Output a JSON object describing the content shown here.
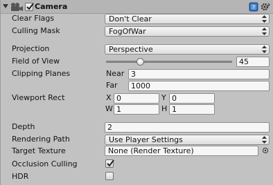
{
  "component": {
    "title": "Camera",
    "enabled": true,
    "icons": [
      "camera-icon",
      "help-icon",
      "gear-icon"
    ]
  },
  "properties": {
    "clear_flags": {
      "label": "Clear Flags",
      "value": "Don't Clear"
    },
    "culling_mask": {
      "label": "Culling Mask",
      "value": "FogOfWar"
    },
    "projection": {
      "label": "Projection",
      "value": "Perspective"
    },
    "field_of_view": {
      "label": "Field of View",
      "value": "45",
      "slider_fraction": 0.26
    },
    "clipping_planes": {
      "label": "Clipping Planes",
      "near_label": "Near",
      "near_value": "3",
      "far_label": "Far",
      "far_value": "1000"
    },
    "viewport_rect": {
      "label": "Viewport Rect",
      "x_label": "X",
      "x_value": "0",
      "y_label": "Y",
      "y_value": "0",
      "w_label": "W",
      "w_value": "1",
      "h_label": "H",
      "h_value": "1"
    },
    "depth": {
      "label": "Depth",
      "value": "2"
    },
    "rendering_path": {
      "label": "Rendering Path",
      "value": "Use Player Settings"
    },
    "target_texture": {
      "label": "Target Texture",
      "value": "None (Render Texture)"
    },
    "occlusion_culling": {
      "label": "Occlusion Culling",
      "checked": true
    },
    "hdr": {
      "label": "HDR",
      "checked": false
    }
  },
  "colors": {
    "panel_bg": "#c2c2c2",
    "header_bg": "#b5b5b5",
    "help_icon": "#2f6db5"
  }
}
